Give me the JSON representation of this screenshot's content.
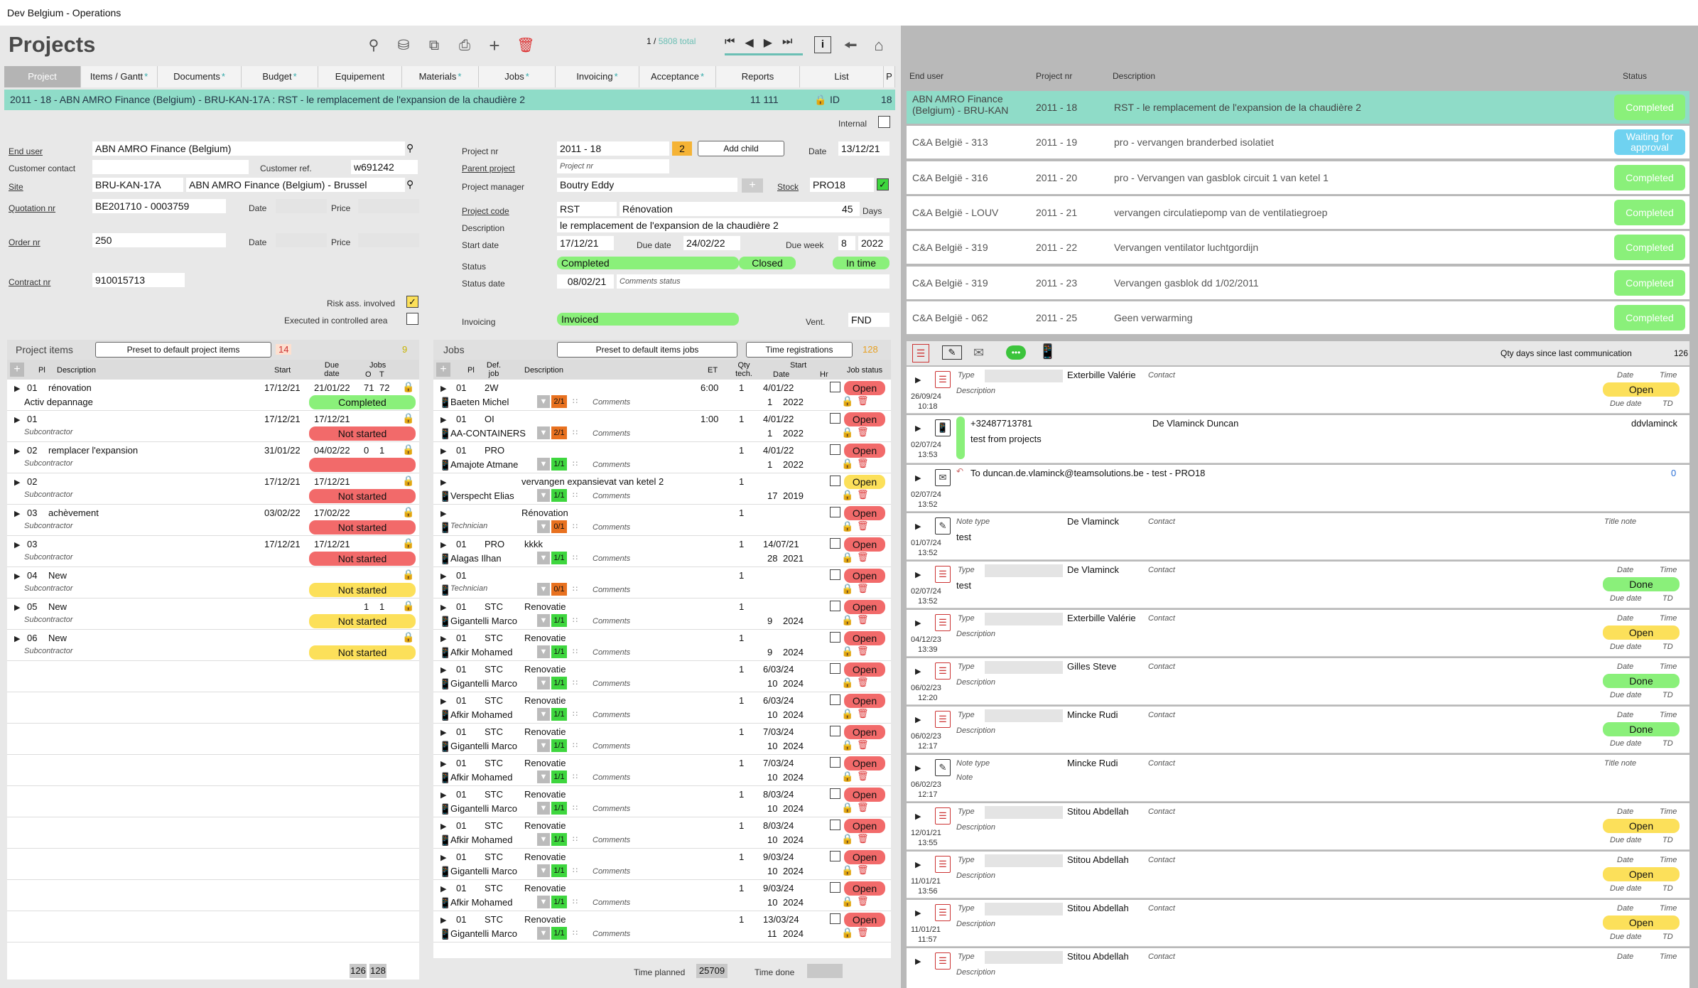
{
  "window": {
    "title": "Dev Belgium - Operations"
  },
  "header": {
    "title": "Projects",
    "pager": "1 /",
    "total": "5808 total"
  },
  "tabs": [
    "Project",
    "Items / Gantt",
    "Documents",
    "Budget",
    "Equipement",
    "Materials",
    "Jobs",
    "Invoicing",
    "Acceptance",
    "Reports",
    "List",
    "P"
  ],
  "project_bar": {
    "text": "2011 - 18 - ABN AMRO Finance (Belgium) - BRU-KAN-17A : RST - le remplacement de l'expansion de la chaudière 2",
    "amount": "11 111",
    "id_label": "ID",
    "id": "18"
  },
  "internal_label": "Internal",
  "form": {
    "end_user_label": "End user",
    "end_user": "ABN AMRO Finance (Belgium)",
    "customer_contact_label": "Customer contact",
    "customer_ref_label": "Customer ref.",
    "customer_ref": "w691242",
    "site_label": "Site",
    "site_code": "BRU-KAN-17A",
    "site_name": "ABN AMRO Finance (Belgium) - Brussel",
    "quotation_label": "Quotation nr",
    "quotation": "BE201710 - 0003759",
    "date_label": "Date",
    "price_label": "Price",
    "order_label": "Order nr",
    "order": "250",
    "contract_label": "Contract nr",
    "contract": "910015713",
    "risk_label": "Risk ass. involved",
    "controlled_label": "Executed in controlled area",
    "project_nr_label": "Project nr",
    "project_nr": "2011 - 18",
    "child_count": "2",
    "add_child": "Add child",
    "proj_date": "13/12/21",
    "parent_label": "Parent project",
    "parent_placeholder": "Project nr",
    "pm_label": "Project manager",
    "pm": "Boutry Eddy",
    "stock_label": "Stock",
    "stock": "PRO18",
    "code_label": "Project code",
    "code": "RST",
    "code_desc": "Rénovation",
    "days": "45",
    "days_label": "Days",
    "desc_label": "Description",
    "desc": "le remplacement de l'expansion de la chaudière 2",
    "start_label": "Start date",
    "start": "17/12/21",
    "due_label": "Due date",
    "due": "24/02/22",
    "week_label": "Due week",
    "week": "8",
    "year": "2022",
    "status_label": "Status",
    "status": "Completed",
    "closed": "Closed",
    "intime": "In time",
    "status_date_label": "Status date",
    "status_date": "08/02/21",
    "comments_status": "Comments status",
    "invoicing_label": "Invoicing",
    "invoicing": "Invoiced",
    "vent_label": "Vent.",
    "vent": "FND"
  },
  "project_items": {
    "title": "Project items",
    "preset": "Preset to default project items",
    "count_badge": "14",
    "count": "9",
    "cols": {
      "pl": "Pl",
      "desc": "Description",
      "start": "Start",
      "due": "Due date",
      "jobs": "Jobs",
      "o": "O",
      "t": "T"
    },
    "rows": [
      {
        "pl": "01",
        "desc": "rénovation",
        "start": "17/12/21",
        "due": "21/01/22",
        "o": "71",
        "t": "72",
        "sub": "Activ depannage",
        "status": "Completed",
        "color": "#8af07a"
      },
      {
        "pl": "01",
        "desc": "",
        "start": "17/12/21",
        "due": "17/12/21",
        "o": "",
        "t": "",
        "sub": "Subcontractor",
        "status": "Not started",
        "color": "#f26a6a"
      },
      {
        "pl": "02",
        "desc": "remplacer l'expansion",
        "start": "31/01/22",
        "due": "04/02/22",
        "o": "0",
        "t": "1",
        "sub": "Subcontractor",
        "status": "",
        "color": "#f26a6a"
      },
      {
        "pl": "02",
        "desc": "",
        "start": "17/12/21",
        "due": "17/12/21",
        "o": "",
        "t": "",
        "sub": "Subcontractor",
        "status": "Not started",
        "color": "#f26a6a"
      },
      {
        "pl": "03",
        "desc": "achèvement",
        "start": "03/02/22",
        "due": "17/02/22",
        "o": "",
        "t": "",
        "sub": "Subcontractor",
        "status": "Not started",
        "color": "#f26a6a"
      },
      {
        "pl": "03",
        "desc": "",
        "start": "17/12/21",
        "due": "17/12/21",
        "o": "",
        "t": "",
        "sub": "Subcontractor",
        "status": "Not started",
        "color": "#f26a6a"
      },
      {
        "pl": "04",
        "desc": "New",
        "start": "",
        "due": "",
        "o": "",
        "t": "",
        "sub": "Subcontractor",
        "status": "Not started",
        "color": "#fce05a"
      },
      {
        "pl": "05",
        "desc": "New",
        "start": "",
        "due": "",
        "o": "1",
        "t": "1",
        "sub": "Subcontractor",
        "status": "Not started",
        "color": "#fce05a"
      },
      {
        "pl": "06",
        "desc": "New",
        "start": "",
        "due": "",
        "o": "",
        "t": "",
        "sub": "Subcontractor",
        "status": "Not started",
        "color": "#fce05a"
      }
    ],
    "total_o": "126",
    "total_t": "128"
  },
  "jobs": {
    "title": "Jobs",
    "preset": "Preset to default items jobs",
    "time_reg": "Time registrations",
    "count": "128",
    "cols": {
      "pl": "Pl",
      "def": "Def. job",
      "desc": "Description",
      "et": "ET",
      "qty": "Qty tech.",
      "start": "Start",
      "date": "Date",
      "hr": "Hr",
      "status": "Job status"
    },
    "comments": "Comments",
    "rows": [
      {
        "pl": "01",
        "def": "2W",
        "desc": "",
        "et": "6:00",
        "qty": "1",
        "date": "4/01/22",
        "hr": "",
        "tech": "Baeten Michel",
        "week": "1",
        "year": "2022",
        "frac": "2/1",
        "fc": "#e8711f",
        "status": "Open",
        "sc": "#f26a6a"
      },
      {
        "pl": "01",
        "def": "OI",
        "desc": "",
        "et": "1:00",
        "qty": "1",
        "date": "4/01/22",
        "hr": "",
        "tech": "AA-CONTAINERS",
        "week": "1",
        "year": "2022",
        "frac": "2/1",
        "fc": "#e8711f",
        "status": "Open",
        "sc": "#f26a6a"
      },
      {
        "pl": "01",
        "def": "PRO",
        "desc": "",
        "et": "",
        "qty": "1",
        "date": "4/01/22",
        "hr": "",
        "tech": "Amajote Atmane",
        "week": "1",
        "year": "2022",
        "frac": "1/1",
        "fc": "#3ed63e",
        "status": "Open",
        "sc": "#f26a6a"
      },
      {
        "pl": "",
        "def": "",
        "desc": "vervangen expansievat van ketel 2",
        "et": "",
        "qty": "1",
        "date": "",
        "hr": "",
        "tech": "Verspecht Elias",
        "week": "17",
        "year": "2019",
        "frac": "1/1",
        "fc": "#3ed63e",
        "status": "Open",
        "sc": "#fce05a"
      },
      {
        "pl": "",
        "def": "",
        "desc": "Rénovation",
        "et": "",
        "qty": "1",
        "date": "",
        "hr": "",
        "tech": "Technician",
        "week": "",
        "year": "",
        "frac": "0/1",
        "fc": "#e8711f",
        "status": "Open",
        "sc": "#f26a6a"
      },
      {
        "pl": "01",
        "def": "PRO",
        "desc": "kkkk",
        "et": "",
        "qty": "1",
        "date": "14/07/21",
        "hr": "",
        "tech": "Alagas Ilhan",
        "week": "28",
        "year": "2021",
        "frac": "1/1",
        "fc": "#3ed63e",
        "status": "Open",
        "sc": "#f26a6a"
      },
      {
        "pl": "01",
        "def": "",
        "desc": "",
        "et": "",
        "qty": "1",
        "date": "",
        "hr": "",
        "tech": "Technician",
        "week": "",
        "year": "",
        "frac": "0/1",
        "fc": "#e8711f",
        "status": "Open",
        "sc": "#f26a6a"
      },
      {
        "pl": "01",
        "def": "STC",
        "desc": "Renovatie",
        "et": "",
        "qty": "1",
        "date": "",
        "hr": "",
        "tech": "Gigantelli Marco",
        "week": "9",
        "year": "2024",
        "frac": "1/1",
        "fc": "#3ed63e",
        "status": "Open",
        "sc": "#f26a6a"
      },
      {
        "pl": "01",
        "def": "STC",
        "desc": "Renovatie",
        "et": "",
        "qty": "1",
        "date": "",
        "hr": "",
        "tech": "Afkir Mohamed",
        "week": "9",
        "year": "2024",
        "frac": "1/1",
        "fc": "#3ed63e",
        "status": "Open",
        "sc": "#f26a6a"
      },
      {
        "pl": "01",
        "def": "STC",
        "desc": "Renovatie",
        "et": "",
        "qty": "1",
        "date": "6/03/24",
        "hr": "",
        "tech": "Gigantelli Marco",
        "week": "10",
        "year": "2024",
        "frac": "1/1",
        "fc": "#3ed63e",
        "status": "Open",
        "sc": "#f26a6a"
      },
      {
        "pl": "01",
        "def": "STC",
        "desc": "Renovatie",
        "et": "",
        "qty": "1",
        "date": "6/03/24",
        "hr": "",
        "tech": "Afkir Mohamed",
        "week": "10",
        "year": "2024",
        "frac": "1/1",
        "fc": "#3ed63e",
        "status": "Open",
        "sc": "#f26a6a"
      },
      {
        "pl": "01",
        "def": "STC",
        "desc": "Renovatie",
        "et": "",
        "qty": "1",
        "date": "7/03/24",
        "hr": "",
        "tech": "Gigantelli Marco",
        "week": "10",
        "year": "2024",
        "frac": "1/1",
        "fc": "#3ed63e",
        "status": "Open",
        "sc": "#f26a6a"
      },
      {
        "pl": "01",
        "def": "STC",
        "desc": "Renovatie",
        "et": "",
        "qty": "1",
        "date": "7/03/24",
        "hr": "",
        "tech": "Afkir Mohamed",
        "week": "10",
        "year": "2024",
        "frac": "1/1",
        "fc": "#3ed63e",
        "status": "Open",
        "sc": "#f26a6a"
      },
      {
        "pl": "01",
        "def": "STC",
        "desc": "Renovatie",
        "et": "",
        "qty": "1",
        "date": "8/03/24",
        "hr": "",
        "tech": "Gigantelli Marco",
        "week": "10",
        "year": "2024",
        "frac": "1/1",
        "fc": "#3ed63e",
        "status": "Open",
        "sc": "#f26a6a"
      },
      {
        "pl": "01",
        "def": "STC",
        "desc": "Renovatie",
        "et": "",
        "qty": "1",
        "date": "8/03/24",
        "hr": "",
        "tech": "Afkir Mohamed",
        "week": "10",
        "year": "2024",
        "frac": "1/1",
        "fc": "#3ed63e",
        "status": "Open",
        "sc": "#f26a6a"
      },
      {
        "pl": "01",
        "def": "STC",
        "desc": "Renovatie",
        "et": "",
        "qty": "1",
        "date": "9/03/24",
        "hr": "",
        "tech": "Gigantelli Marco",
        "week": "10",
        "year": "2024",
        "frac": "1/1",
        "fc": "#3ed63e",
        "status": "Open",
        "sc": "#f26a6a"
      },
      {
        "pl": "01",
        "def": "STC",
        "desc": "Renovatie",
        "et": "",
        "qty": "1",
        "date": "9/03/24",
        "hr": "",
        "tech": "Afkir Mohamed",
        "week": "10",
        "year": "2024",
        "frac": "1/1",
        "fc": "#3ed63e",
        "status": "Open",
        "sc": "#f26a6a"
      },
      {
        "pl": "01",
        "def": "STC",
        "desc": "Renovatie",
        "et": "",
        "qty": "1",
        "date": "13/03/24",
        "hr": "",
        "tech": "Gigantelli Marco",
        "week": "11",
        "year": "2024",
        "frac": "1/1",
        "fc": "#3ed63e",
        "status": "Open",
        "sc": "#f26a6a"
      }
    ],
    "time_planned_label": "Time planned",
    "time_planned": "25709",
    "time_done_label": "Time done"
  },
  "list": {
    "cols": {
      "end_user": "End user",
      "project_nr": "Project nr",
      "description": "Description",
      "status": "Status"
    },
    "rows": [
      {
        "end_user": "ABN AMRO Finance (Belgium) - BRU-KAN",
        "nr": "2011 - 18",
        "desc": "RST - le remplacement de l'expansion de la chaudière 2",
        "status": "Completed",
        "color": "#8af07a"
      },
      {
        "end_user": "C&A België - 313",
        "nr": "2011 - 19",
        "desc": "pro - vervangen branderbed isolatiet",
        "status": "Waiting for approval",
        "color": "#6fd2f0"
      },
      {
        "end_user": "C&A België - 316",
        "nr": "2011 - 20",
        "desc": "pro - Vervangen van gasblok circuit 1 van ketel 1",
        "status": "Completed",
        "color": "#8af07a"
      },
      {
        "end_user": "C&A België - LOUV",
        "nr": "2011 - 21",
        "desc": "vervangen circulatiepomp van de ventilatiegroep",
        "status": "Completed",
        "color": "#8af07a"
      },
      {
        "end_user": "C&A België - 319",
        "nr": "2011 - 22",
        "desc": "Vervangen ventilator luchtgordijn",
        "status": "Completed",
        "color": "#8af07a"
      },
      {
        "end_user": "C&A België - 319",
        "nr": "2011 - 23",
        "desc": "Vervangen gasblok dd 1/02/2011",
        "status": "Completed",
        "color": "#8af07a"
      },
      {
        "end_user": "C&A België - 062",
        "nr": "2011 - 25",
        "desc": "Geen verwarming",
        "status": "Completed",
        "color": "#8af07a"
      }
    ]
  },
  "comm": {
    "qty_label": "Qty days since last communication",
    "qty": "126",
    "labels": {
      "type": "Type",
      "description": "Description",
      "contact": "Contact",
      "date": "Date",
      "time": "Time",
      "due_date": "Due date",
      "td": "TD",
      "note_type": "Note type",
      "title_note": "Title note",
      "note": "Note"
    },
    "items": [
      {
        "kind": "task",
        "date": "26/09/24",
        "time": "10:18",
        "name": "Exterbille Valérie",
        "status": "Open",
        "color": "#fce05a"
      },
      {
        "kind": "phone",
        "date": "02/07/24",
        "time": "13:53",
        "phone": "+32487713781",
        "name": "De Vlaminck Duncan",
        "text": "test from projects",
        "user": "ddvlaminck"
      },
      {
        "kind": "mail",
        "date": "02/07/24",
        "time": "13:52",
        "text": "To duncan.de.vlaminck@teamsolutions.be - test - PRO18",
        "count": "0"
      },
      {
        "kind": "note",
        "date": "01/07/24",
        "time": "13:52",
        "name": "De Vlaminck",
        "text": "test"
      },
      {
        "kind": "task",
        "date": "02/07/24",
        "time": "13:52",
        "name": "De Vlaminck",
        "text": "test",
        "status": "Done",
        "color": "#8af07a"
      },
      {
        "kind": "task",
        "date": "04/12/23",
        "time": "13:39",
        "name": "Exterbille Valérie",
        "status": "Open",
        "color": "#fce05a"
      },
      {
        "kind": "task",
        "date": "06/02/23",
        "time": "12:20",
        "name": "Gilles Steve",
        "status": "Done",
        "color": "#8af07a"
      },
      {
        "kind": "task",
        "date": "06/02/23",
        "time": "12:17",
        "name": "Mincke Rudi",
        "status": "Done",
        "color": "#8af07a"
      },
      {
        "kind": "note",
        "date": "06/02/23",
        "time": "12:17",
        "name": "Mincke Rudi",
        "text": ""
      },
      {
        "kind": "task",
        "date": "12/01/21",
        "time": "13:55",
        "name": "Stitou Abdellah",
        "status": "Open",
        "color": "#fce05a"
      },
      {
        "kind": "task",
        "date": "11/01/21",
        "time": "13:56",
        "name": "Stitou Abdellah",
        "status": "Open",
        "color": "#fce05a"
      },
      {
        "kind": "task",
        "date": "11/01/21",
        "time": "11:57",
        "name": "Stitou Abdellah",
        "status": "Open",
        "color": "#fce05a"
      },
      {
        "kind": "task",
        "date": "",
        "time": "",
        "name": "Stitou Abdellah",
        "status": "",
        "color": ""
      }
    ]
  }
}
